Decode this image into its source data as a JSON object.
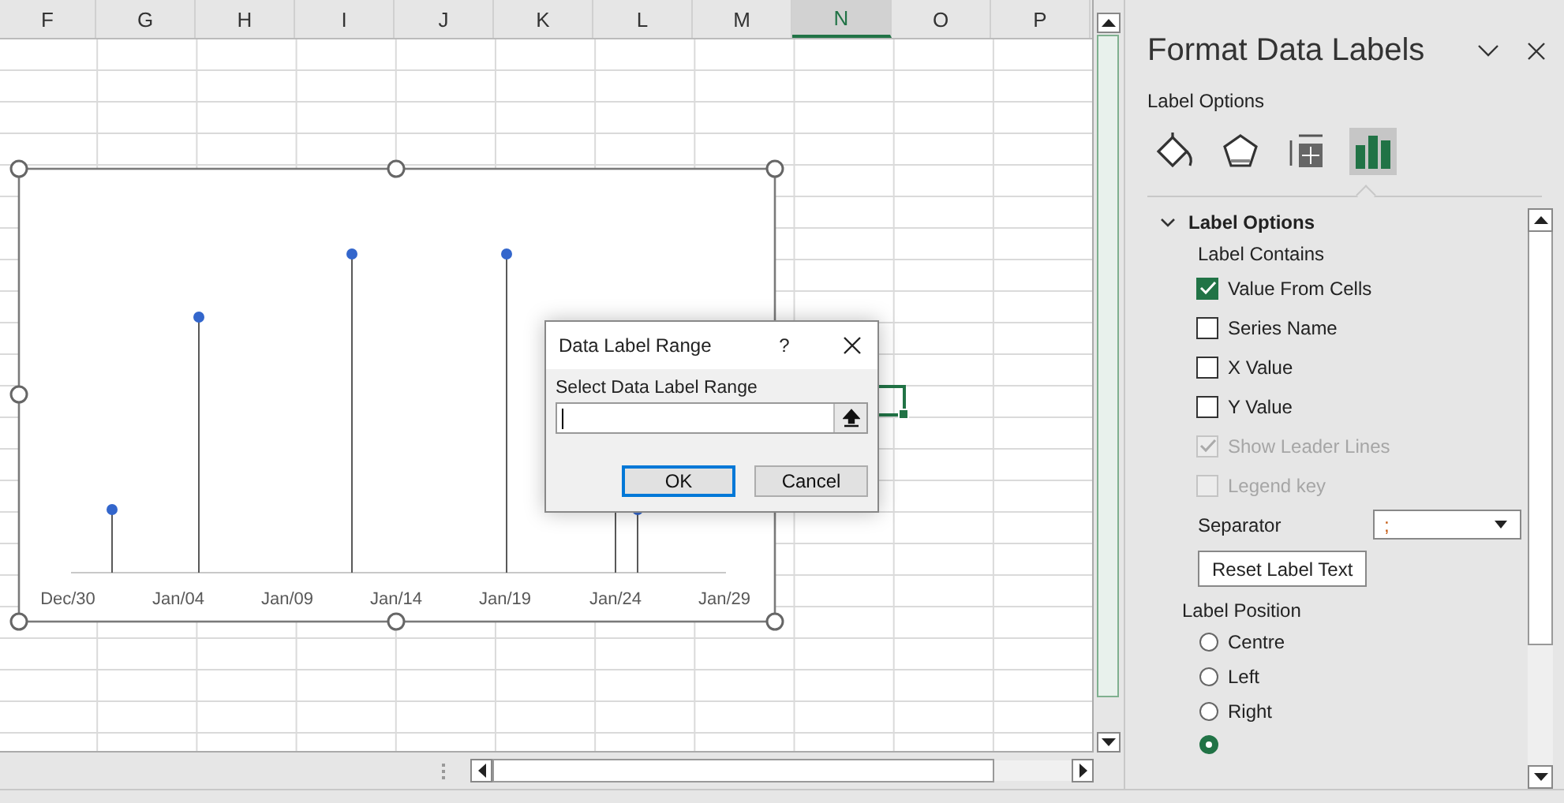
{
  "grid": {
    "columns": [
      {
        "label": "F",
        "selected": false
      },
      {
        "label": "G",
        "selected": false
      },
      {
        "label": "H",
        "selected": false
      },
      {
        "label": "I",
        "selected": false
      },
      {
        "label": "J",
        "selected": false
      },
      {
        "label": "K",
        "selected": false
      },
      {
        "label": "L",
        "selected": false
      },
      {
        "label": "M",
        "selected": false
      },
      {
        "label": "N",
        "selected": true
      },
      {
        "label": "O",
        "selected": false
      },
      {
        "label": "P",
        "selected": false
      }
    ]
  },
  "chart": {
    "x_axis_labels": [
      "Dec/30",
      "Jan/04",
      "Jan/09",
      "Jan/14",
      "Jan/19",
      "Jan/24",
      "Jan/29"
    ]
  },
  "dialog": {
    "title": "Data Label Range",
    "help": "?",
    "field_label": "Select Data Label Range",
    "buttons": [
      {
        "label": "OK",
        "default": true
      },
      {
        "label": "Cancel",
        "default": false
      }
    ]
  },
  "pane": {
    "title": "Format Data Labels",
    "subtitle": "Label Options",
    "icon_tabs": [
      {
        "kind": "fill",
        "selected": false
      },
      {
        "kind": "effects",
        "selected": false
      },
      {
        "kind": "size",
        "selected": false
      },
      {
        "kind": "options",
        "selected": true
      }
    ],
    "section": {
      "title": "Label Options",
      "expanded": true
    },
    "contains_label": "Label Contains",
    "checkboxes": [
      {
        "label": "Value From Cells",
        "checked": true,
        "disabled": false
      },
      {
        "label": "Series Name",
        "checked": false,
        "disabled": false
      },
      {
        "label": "X Value",
        "checked": false,
        "disabled": false
      },
      {
        "label": "Y Value",
        "checked": false,
        "disabled": false
      },
      {
        "label": "Show Leader Lines",
        "checked": true,
        "disabled": true
      },
      {
        "label": "Legend key",
        "checked": false,
        "disabled": true
      }
    ],
    "separator": {
      "label": "Separator",
      "value": ";"
    },
    "reset_button": "Reset Label Text",
    "position_label": "Label Position",
    "positions": [
      {
        "label": "Centre",
        "selected": false
      },
      {
        "label": "Left",
        "selected": false
      },
      {
        "label": "Right",
        "selected": false
      }
    ],
    "cut_off_radio": {
      "selected": true
    }
  }
}
